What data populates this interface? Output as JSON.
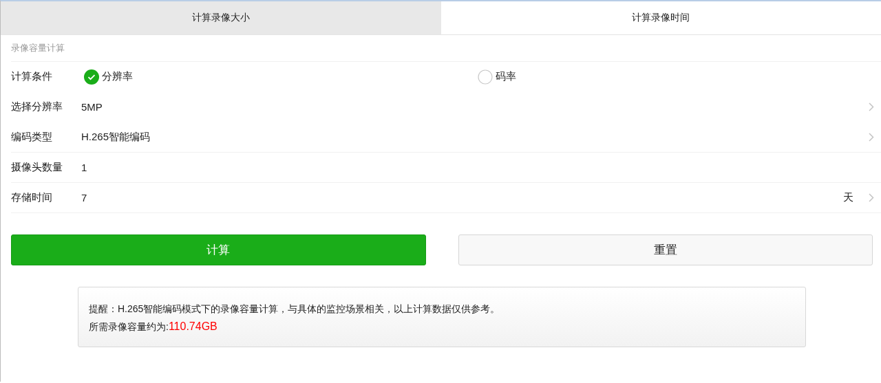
{
  "tabs": [
    {
      "label": "计算录像大小",
      "selected": true
    },
    {
      "label": "计算录像时间",
      "selected": false
    }
  ],
  "section_title": "录像容量计算",
  "condition": {
    "label": "计算条件",
    "options": [
      {
        "label": "分辨率",
        "selected": true
      },
      {
        "label": "码率",
        "selected": false
      }
    ]
  },
  "fields": [
    {
      "kind": "select",
      "label": "选择分辨率",
      "value": "5MP"
    },
    {
      "kind": "select",
      "label": "编码类型",
      "value": "H.265智能编码"
    },
    {
      "kind": "input",
      "label": "摄像头数量",
      "value": "1"
    },
    {
      "kind": "select",
      "label": "存储时间",
      "value": "7",
      "unit": "天"
    }
  ],
  "buttons": [
    {
      "kind": "primary",
      "label": "计算"
    },
    {
      "kind": "secondary",
      "label": "重置"
    }
  ],
  "notice": {
    "text": "提醒：H.265智能编码模式下的录像容量计算，与具体的监控场景相关，以上计算数据仅供参考。",
    "result_label": "所需录像容量约为:",
    "result_value": "110.74GB"
  }
}
